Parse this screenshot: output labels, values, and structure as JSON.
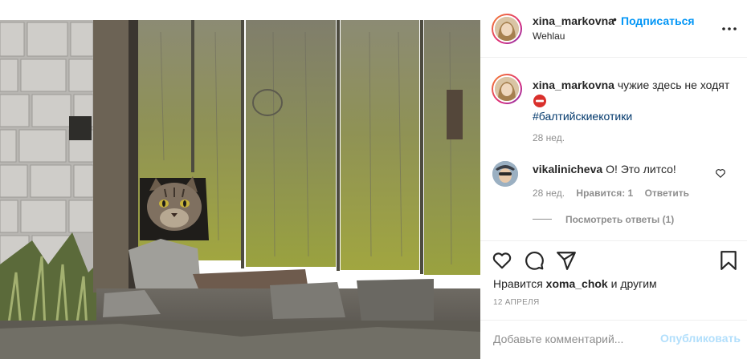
{
  "post": {
    "author": {
      "username": "xina_markovna",
      "location": "Wehlau",
      "follow_label": "Подписаться",
      "separator": "•"
    },
    "caption": {
      "username": "xina_markovna",
      "text": "чужие здесь не ходят",
      "emoji": "no-entry-icon",
      "hashtag": "#балтийскиекотики",
      "time": "28 нед."
    },
    "comments": [
      {
        "username": "vikalinicheva",
        "text": "О! Это литсо!",
        "time": "28 нед.",
        "likes_label": "Нравится: 1",
        "reply_label": "Ответить",
        "view_replies_label": "Посмотреть ответы (1)"
      }
    ],
    "likes": {
      "prefix": "Нравится",
      "user": "xoma_chok",
      "suffix": "и другим"
    },
    "date": "12 АПРЕЛЯ",
    "add_comment": {
      "placeholder": "Добавьте комментарий...",
      "publish_label": "Опубликовать"
    },
    "icons": {
      "more": "more-options-icon",
      "like": "heart-icon",
      "comment": "comment-bubble-icon",
      "share": "paper-plane-icon",
      "save": "bookmark-icon"
    },
    "colors": {
      "link_blue": "#0095f6",
      "hashtag": "#00376b",
      "muted": "#8e8e8e",
      "publish_disabled": "#b2dffc",
      "text": "#262626"
    }
  }
}
